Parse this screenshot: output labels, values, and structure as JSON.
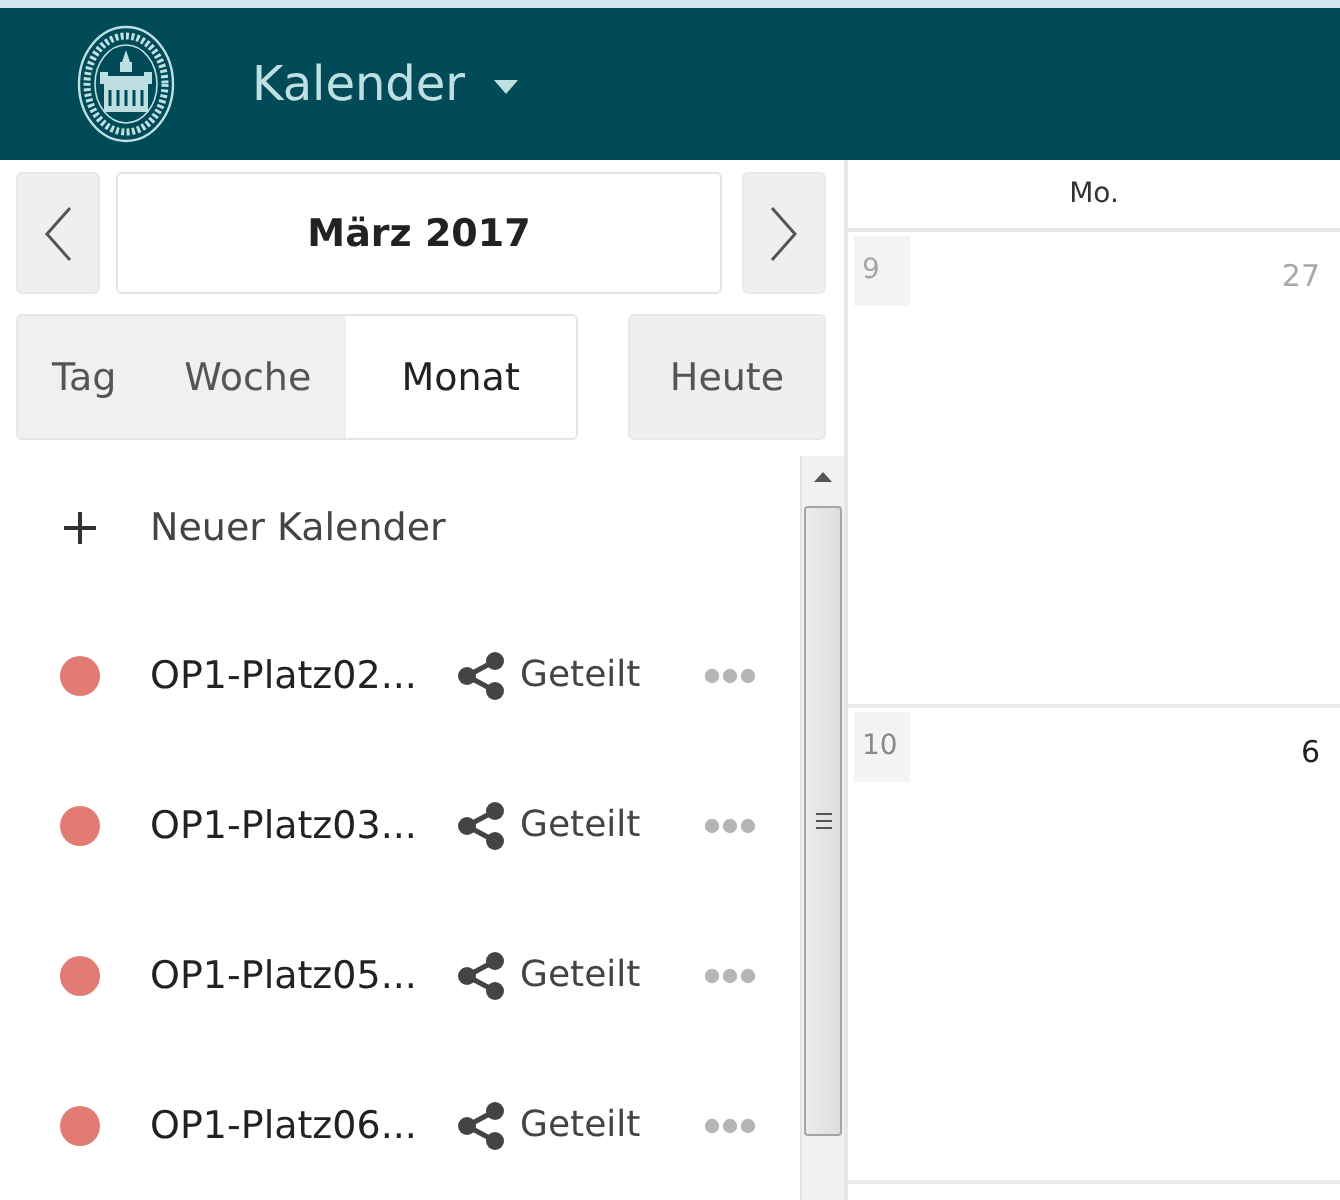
{
  "header": {
    "title": "Kalender"
  },
  "navigator": {
    "month": "März 2017"
  },
  "views": [
    {
      "label": "Tag",
      "selected": false
    },
    {
      "label": "Woche",
      "selected": false
    },
    {
      "label": "Monat",
      "selected": true
    }
  ],
  "today_button": {
    "label": "Heute"
  },
  "new_calendar": {
    "label": "Neuer Kalender"
  },
  "calendars": [
    {
      "name": "OP1-Platz02...",
      "color": "#e27b73",
      "sharing": "Geteilt"
    },
    {
      "name": "OP1-Platz03...",
      "color": "#e27b73",
      "sharing": "Geteilt"
    },
    {
      "name": "OP1-Platz05...",
      "color": "#e27b73",
      "sharing": "Geteilt"
    },
    {
      "name": "OP1-Platz06...",
      "color": "#e27b73",
      "sharing": "Geteilt"
    }
  ],
  "month_view": {
    "weekdays": [
      "Mo."
    ],
    "weeks": [
      {
        "number": "9",
        "days": [
          {
            "label": "27",
            "in_month": false
          }
        ]
      },
      {
        "number": "10",
        "days": [
          {
            "label": "6",
            "in_month": true
          }
        ]
      }
    ]
  }
}
